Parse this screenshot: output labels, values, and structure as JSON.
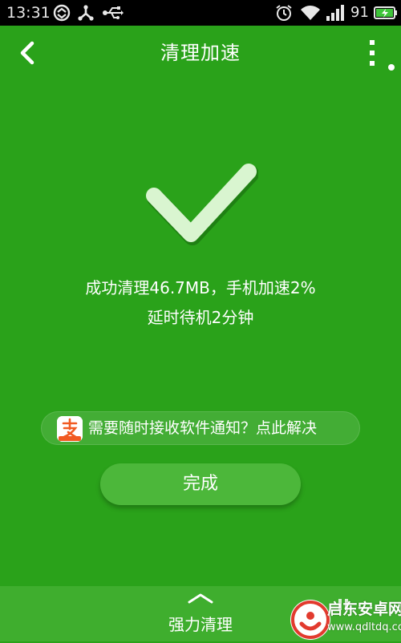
{
  "status_bar": {
    "time": "13:31",
    "battery_level": "91",
    "icons": [
      "sync-icon",
      "usb-debug-icon",
      "usb-icon",
      "alarm-icon",
      "wifi-icon",
      "signal-icon",
      "battery-charging-icon"
    ]
  },
  "header": {
    "title": "清理加速",
    "back_icon": "chevron-left-icon",
    "menu_icon": "more-vertical-icon"
  },
  "result": {
    "line1": "成功清理46.7MB，手机加速2%",
    "line2": "延时待机2分钟",
    "icon": "checkmark-icon"
  },
  "notice": {
    "text": "需要随时接收软件通知？点此解决",
    "icon": "alipay-app-icon"
  },
  "done_button": {
    "label": "完成"
  },
  "bottom_bar": {
    "label": "强力清理",
    "icon": "chevron-up-icon"
  },
  "watermark": {
    "title": "启东安卓网",
    "url": "www.qdltdq.com"
  },
  "colors": {
    "background": "#2aa21a",
    "button": "#4cb73a",
    "bottom_bar": "#3fae2e",
    "status_bar": "#000000",
    "check": "#d9f5d0"
  }
}
